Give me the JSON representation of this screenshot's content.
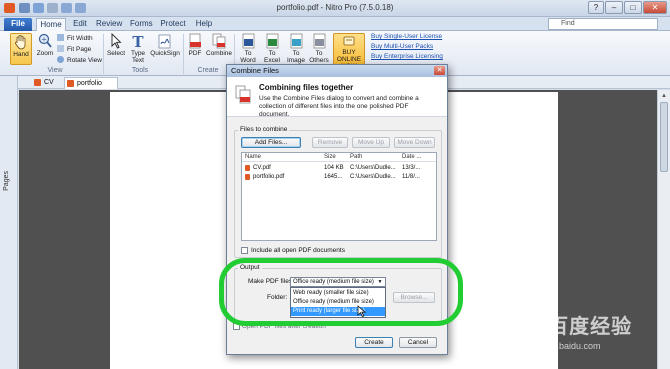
{
  "window": {
    "title": "portfolio.pdf - Nitro Pro (7.5.0.18)",
    "controls": [
      "?",
      "–",
      "□",
      "✕"
    ]
  },
  "ribbon_tabs": [
    "File",
    "Home",
    "Edit",
    "Review",
    "Forms",
    "Protect",
    "Help"
  ],
  "search": {
    "placeholder": "Find"
  },
  "ribbon": {
    "view_group": {
      "label": "View",
      "hand": "Hand",
      "zoom": "Zoom",
      "fit_width": "Fit Width",
      "fit_page": "Fit Page",
      "rotate_view": "Rotate View"
    },
    "tools_group": {
      "label": "Tools",
      "select": "Select",
      "type_text": "Type Text",
      "quicksign": "QuickSign"
    },
    "create_group": {
      "label": "Create",
      "pdf": "PDF",
      "combine": "Combine"
    },
    "convert": {
      "to_word": "To Word",
      "to_excel": "To Excel",
      "to_image": "To Image",
      "to_others": "To Others"
    },
    "buy_online": "BUY ONLINE NOW",
    "buy_links": [
      "Buy Single-User License",
      "Buy Multi-User Packs",
      "Buy Enterprise Licensing"
    ]
  },
  "doc_tabs": [
    "CV",
    "portfolio"
  ],
  "side_panel": {
    "label": "Pages"
  },
  "dialog": {
    "title": "Combine Files",
    "heading": "Combining files together",
    "description": "Use the Combine Files dialog to convert and combine a collection of different files into the one polished PDF document.",
    "files_group": "Files to combine",
    "buttons": {
      "add": "Add Files...",
      "remove": "Remove",
      "move_up": "Move Up",
      "move_down": "Move Down"
    },
    "columns": [
      "Name",
      "Size",
      "Path",
      "Date ..."
    ],
    "files": [
      {
        "name": "CV.pdf",
        "size": "104 KB",
        "path": "C:\\Users\\Dudle...",
        "date": "13/3/..."
      },
      {
        "name": "portfolio.pdf",
        "size": "1645...",
        "path": "C:\\Users\\Dudle...",
        "date": "11/8/..."
      }
    ],
    "include_open": "Include all open PDF documents",
    "output_group": "Output",
    "make_pdf_label": "Make PDF files:",
    "make_pdf_selected": "Office ready (medium file size)",
    "make_pdf_options": [
      "Web ready (smaller file size)",
      "Office ready (medium file size)",
      "Print ready (larger file size)"
    ],
    "highlighted_option_index": 2,
    "folder_label": "Folder:",
    "browse": "Browse...",
    "open_after": "Open PDF files after creation",
    "create": "Create",
    "cancel": "Cancel"
  },
  "watermark": {
    "logo": "Bai百度经验",
    "url": "jingyan.baidu.com"
  },
  "colors": {
    "highlight_ring": "#22cc33",
    "selection": "#3399ff",
    "file_tab": "#2457a8"
  }
}
